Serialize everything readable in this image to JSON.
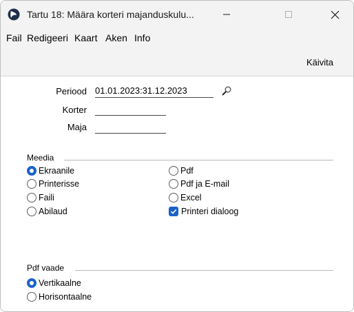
{
  "window": {
    "title": "Tartu 18: Määra korteri majanduskulu...",
    "icon": "app-logo-icon",
    "controls": [
      "minimize-icon",
      "maximize-icon",
      "close-icon"
    ]
  },
  "menu": {
    "items": [
      "Fail",
      "Redigeeri",
      "Kaart",
      "Aken",
      "Info"
    ]
  },
  "toolbar": {
    "run_label": "Käivita"
  },
  "form": {
    "periood_label": "Periood",
    "periood_value": "01.01.2023:31.12.2023",
    "korter_label": "Korter",
    "korter_value": "",
    "maja_label": "Maja",
    "maja_value": ""
  },
  "meedia": {
    "heading": "Meedia",
    "options": [
      {
        "label": "Ekraanile",
        "selected": true
      },
      {
        "label": "Printerisse",
        "selected": false
      },
      {
        "label": "Faili",
        "selected": false
      },
      {
        "label": "Abilaud",
        "selected": false
      },
      {
        "label": "Pdf",
        "selected": false
      },
      {
        "label": "Pdf ja E-mail",
        "selected": false
      },
      {
        "label": "Excel",
        "selected": false
      }
    ],
    "printer_dialog_label": "Printeri dialoog",
    "printer_dialog_checked": true
  },
  "pdf_vaade": {
    "heading": "Pdf vaade",
    "options": [
      {
        "label": "Vertikaalne",
        "selected": true
      },
      {
        "label": "Horisontaalne",
        "selected": false
      }
    ]
  },
  "colors": {
    "accent": "#1a62c7",
    "chrome": "#f3f3f3"
  }
}
